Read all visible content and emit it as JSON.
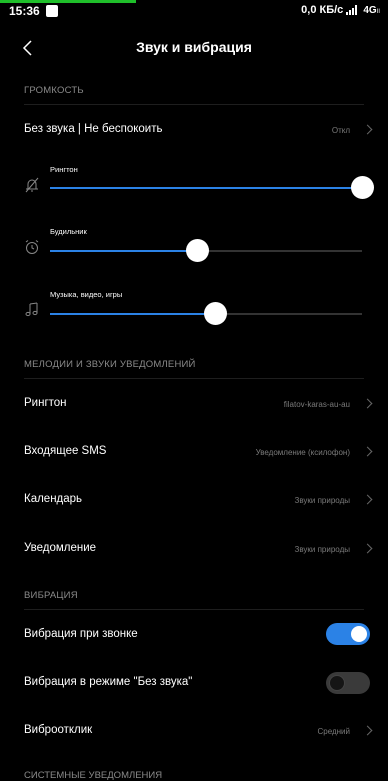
{
  "status_bar": {
    "time": "15:36",
    "speed": "0,0 КБ/с",
    "network": "4G",
    "network_sub": "ll"
  },
  "header": {
    "title": "Звук и вибрация"
  },
  "volume": {
    "section_title": "ГРОМКОСТЬ",
    "dnd_label": "Без звука | Не беспокоить",
    "dnd_value": "Откл",
    "sliders": [
      {
        "label": "Рингтон",
        "level": 1.0,
        "icon": "bell-off-icon"
      },
      {
        "label": "Будильник",
        "level": 0.47,
        "icon": "alarm-clock-icon"
      },
      {
        "label": "Музыка, видео, игры",
        "level": 0.53,
        "icon": "music-note-icon"
      }
    ]
  },
  "sounds": {
    "section_title": "МЕЛОДИИ И ЗВУКИ УВЕДОМЛЕНИЙ",
    "items": [
      {
        "label": "Рингтон",
        "value": "filatov-karas-au-au"
      },
      {
        "label": "Входящее SMS",
        "value": "Уведомление (ксилофон)"
      },
      {
        "label": "Календарь",
        "value": "Звуки природы"
      },
      {
        "label": "Уведомление",
        "value": "Звуки природы"
      }
    ]
  },
  "vibration": {
    "section_title": "ВИБРАЦИЯ",
    "ring_label": "Вибрация при звонке",
    "ring_on": true,
    "silent_label": "Вибрация в режиме \"Без звука\"",
    "silent_on": false,
    "feedback_label": "Виброотклик",
    "feedback_value": "Средний"
  },
  "system": {
    "section_title": "СИСТЕМНЫЕ УВЕДОМЛЕНИЯ"
  },
  "colors": {
    "accent": "#2b82e6",
    "background": "#000000",
    "section": "#8a8a8a"
  }
}
